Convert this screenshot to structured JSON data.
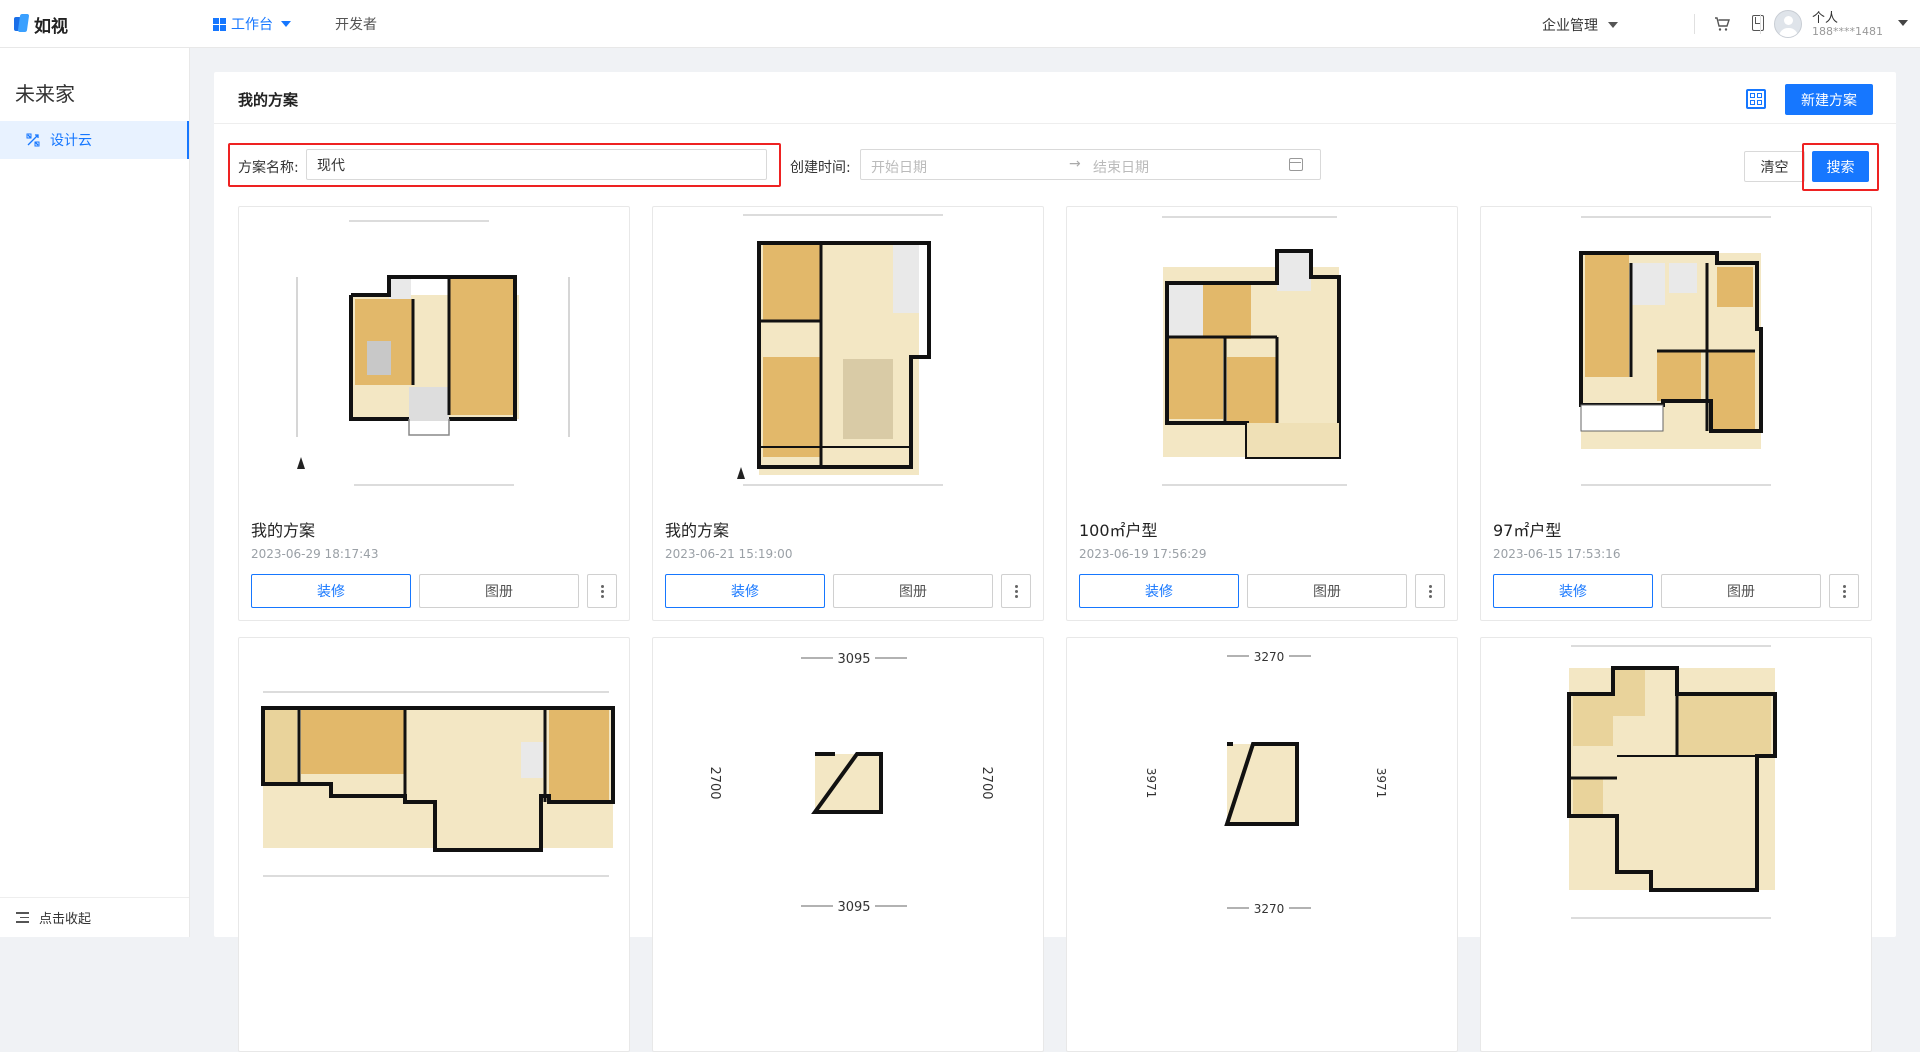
{
  "brand": {
    "logo_text": "如视"
  },
  "nav": {
    "workbench": "工作台",
    "developer": "开发者"
  },
  "header": {
    "enterprise": "企业管理",
    "user_name": "个人",
    "user_phone": "188****1481"
  },
  "sidebar": {
    "title": "未来家",
    "items": [
      {
        "label": "设计云"
      }
    ],
    "collapse_label": "点击收起"
  },
  "page": {
    "title": "我的方案",
    "new_button": "新建方案"
  },
  "filters": {
    "name_label": "方案名称:",
    "name_value": "现代",
    "time_label": "创建时间:",
    "start_placeholder": "开始日期",
    "arrow": "→",
    "end_placeholder": "结束日期",
    "clear_button": "清空",
    "search_button": "搜索"
  },
  "card_buttons": {
    "decorate": "装修",
    "album": "图册"
  },
  "cards": [
    {
      "title": "我的方案",
      "date": "2023-06-29 18:17:43"
    },
    {
      "title": "我的方案",
      "date": "2023-06-21 15:19:00"
    },
    {
      "title": "100㎡户型",
      "date": "2023-06-19 17:56:29"
    },
    {
      "title": "97㎡户型",
      "date": "2023-06-15 17:53:16"
    },
    {
      "title": "",
      "date": ""
    },
    {
      "title": "",
      "date": ""
    },
    {
      "title": "",
      "date": ""
    },
    {
      "title": "",
      "date": ""
    }
  ],
  "plan_dims": {
    "card6_width": "3095",
    "card6_height": "2700",
    "card7_width": "3270",
    "card7_height": "3971"
  },
  "colors": {
    "accent": "#1677ff",
    "highlight_red": "#e22",
    "wood": "#e2b86a",
    "tile": "#f3e7c4"
  }
}
